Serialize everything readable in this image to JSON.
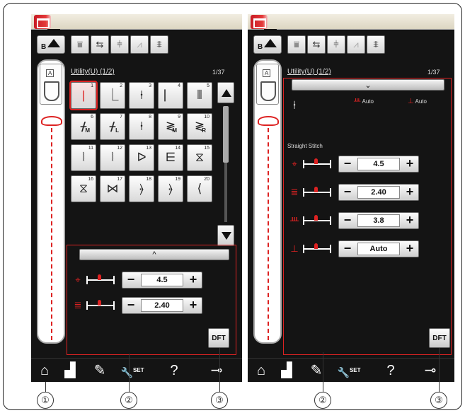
{
  "left_screen": {
    "foot_letter": "A",
    "bdrop_label": "B",
    "toolbar_icons": [
      "tie-off-icon",
      "twin-needle-icon",
      "alignment-icon",
      "needle-icon",
      "feed-dog-icon"
    ],
    "title": "Utility(U) (1/2)",
    "page_count": "1/37",
    "stitches": [
      {
        "num": "1",
        "glyph": "|",
        "sub": ""
      },
      {
        "num": "2",
        "glyph": "⎿",
        "sub": ""
      },
      {
        "num": "3",
        "glyph": "⍿",
        "sub": ""
      },
      {
        "num": "4",
        "glyph": "⎸",
        "sub": ""
      },
      {
        "num": "5",
        "glyph": "⦀",
        "sub": ""
      },
      {
        "num": "6",
        "glyph": "ᚋ",
        "sub": "M"
      },
      {
        "num": "7",
        "glyph": "ᚋ",
        "sub": "L"
      },
      {
        "num": "8",
        "glyph": "⍿",
        "sub": ""
      },
      {
        "num": "9",
        "glyph": "≷",
        "sub": "M"
      },
      {
        "num": "10",
        "glyph": "≷",
        "sub": "R"
      },
      {
        "num": "11",
        "glyph": "⦚",
        "sub": ""
      },
      {
        "num": "12",
        "glyph": "⦚",
        "sub": ""
      },
      {
        "num": "13",
        "glyph": "ᐅ",
        "sub": ""
      },
      {
        "num": "14",
        "glyph": "⋿",
        "sub": ""
      },
      {
        "num": "15",
        "glyph": "⧖",
        "sub": ""
      },
      {
        "num": "16",
        "glyph": "⧖",
        "sub": ""
      },
      {
        "num": "17",
        "glyph": "⋈",
        "sub": ""
      },
      {
        "num": "18",
        "glyph": "⦒",
        "sub": ""
      },
      {
        "num": "19",
        "glyph": "⦒",
        "sub": ""
      },
      {
        "num": "20",
        "glyph": "⟨",
        "sub": ""
      }
    ],
    "collapse_label": "^",
    "params": [
      {
        "icon": "⌖",
        "value": "4.5"
      },
      {
        "icon": "≣",
        "value": "2.40"
      }
    ],
    "dft_label": "DFT"
  },
  "right_screen": {
    "foot_letter": "A",
    "bdrop_label": "B",
    "title": "Utility(U) (1/2)",
    "page_count": "1/37",
    "expand_label": "⌄",
    "auto_tension": "Auto",
    "auto_foot": "Auto",
    "section_label": "Straight Stitch",
    "params": [
      {
        "icon": "⌖",
        "value": "4.5"
      },
      {
        "icon": "≣",
        "value": "2.40"
      },
      {
        "icon": "ᚈ",
        "value": "3.8"
      },
      {
        "icon": "⊥",
        "value": "Auto"
      }
    ],
    "dft_label": "DFT"
  },
  "bottom_bar": {
    "set_label": "SET",
    "help_label": "?"
  },
  "callouts": [
    "①",
    "②",
    "③",
    "②",
    "③"
  ]
}
